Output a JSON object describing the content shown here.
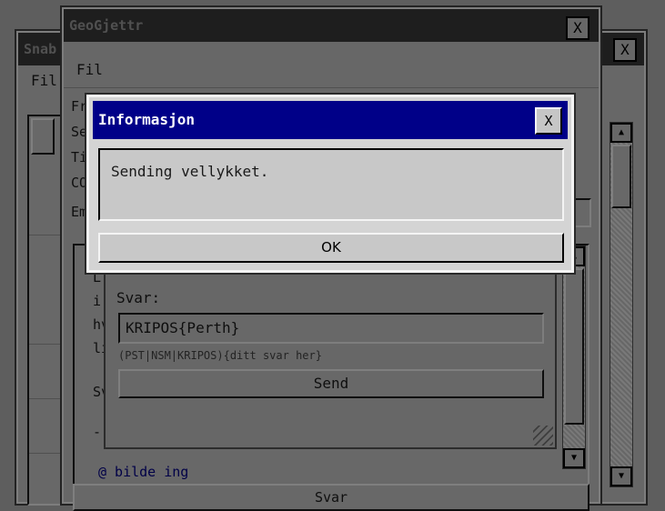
{
  "back_window": {
    "title": "Snab",
    "close_label": "X",
    "menu_file": "Fil"
  },
  "main_window": {
    "title": "GeoGjettr",
    "close_label": "X",
    "menu_file": "Fil",
    "field_fragments": [
      "Fr",
      "Se",
      "Ti",
      "CO"
    ],
    "email_fragment": "Em",
    "body_fragments": [
      "L",
      "i",
      "hv",
      "li",
      "Sv",
      "-"
    ],
    "image_fragment": "@ bilde ing",
    "bottom_button_fragment": "Svar"
  },
  "answer_panel": {
    "svar_label": "Svar:",
    "answer_value": "KRIPOS{Perth}",
    "answer_hint": "(PST|NSM|KRIPOS){ditt svar her}",
    "send_label": "Send"
  },
  "dialog": {
    "title": "Informasjon",
    "close_label": "X",
    "message": "Sending vellykket.",
    "ok_label": "OK"
  },
  "icons": {
    "scroll_up": "up-arrow-icon",
    "scroll_down": "down-arrow-icon",
    "resize": "resize-grip-icon"
  }
}
